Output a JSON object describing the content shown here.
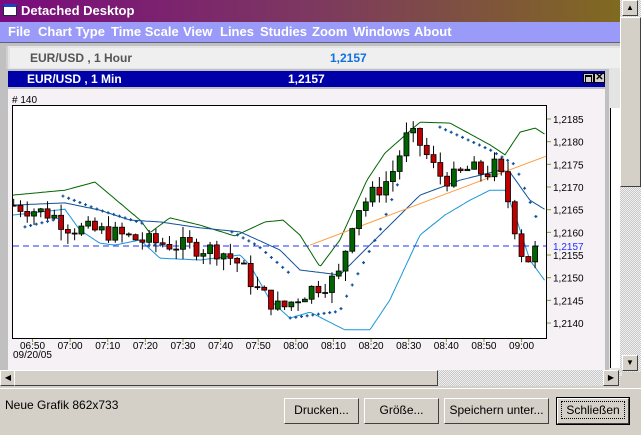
{
  "window": {
    "title": "Detached Desktop"
  },
  "menu": [
    "File",
    "Chart Type",
    "Time Scale",
    "View",
    "Lines",
    "Studies",
    "Zoom",
    "Windows",
    "About"
  ],
  "hour_window": {
    "title": "EUR/USD , 1 Hour",
    "price": "1,2157"
  },
  "min_window": {
    "title": "EUR/USD , 1 Min",
    "price": "1,2157",
    "bar_count": "# 140"
  },
  "status": {
    "text": "Neue Grafik 862x733"
  },
  "buttons": {
    "print": "Drucken...",
    "size": "Größe...",
    "save_as": "Speichern unter...",
    "close": "Schließen"
  },
  "colors": {
    "up": "#006400",
    "down": "#c00000",
    "upper_band": "#006400",
    "middle_band": "#10509a",
    "lower_band": "#1a96d8",
    "sar": "#10509a",
    "trendline": "#ff9a40",
    "hline": "#2030ff"
  },
  "chart_data": {
    "type": "candlestick",
    "symbol": "EUR/USD",
    "interval": "1 Min",
    "date_label": "09/20/05",
    "x_ticks": [
      "06:50",
      "07:00",
      "07:10",
      "07:20",
      "07:30",
      "07:40",
      "07:50",
      "08:00",
      "08:10",
      "08:20",
      "08:30",
      "08:40",
      "08:50",
      "09:00"
    ],
    "y_ticks": [
      "1,2140",
      "1,2145",
      "1,2150",
      "1,2155",
      "1,2160",
      "1,2165",
      "1,2170",
      "1,2175",
      "1,2180",
      "1,2185"
    ],
    "y_tick_values": [
      1.214,
      1.2145,
      1.215,
      1.2155,
      1.216,
      1.2165,
      1.217,
      1.2175,
      1.218,
      1.2185
    ],
    "ylim": [
      1.21362,
      1.21885
    ],
    "x_minutes_from_0650": [
      -5.4,
      136.5
    ],
    "price_path": [
      [
        -5,
        1.2166
      ],
      [
        0,
        1.2165
      ],
      [
        5,
        1.2164
      ],
      [
        10,
        1.2161
      ],
      [
        20,
        1.216
      ],
      [
        30,
        1.2158
      ],
      [
        40,
        1.2157
      ],
      [
        50,
        1.2156
      ],
      [
        55,
        1.2153
      ],
      [
        60,
        1.2147
      ],
      [
        66,
        1.2143
      ],
      [
        71,
        1.2146
      ],
      [
        75,
        1.2148
      ],
      [
        79,
        1.2149
      ],
      [
        82,
        1.2151
      ],
      [
        84,
        1.216
      ],
      [
        86,
        1.2165
      ],
      [
        90,
        1.2168
      ],
      [
        95,
        1.2172
      ],
      [
        98,
        1.2178
      ],
      [
        100,
        1.2182
      ],
      [
        103.5,
        1.2179
      ],
      [
        106,
        1.2175
      ],
      [
        109,
        1.2172
      ],
      [
        112,
        1.2172
      ],
      [
        116,
        1.2174
      ],
      [
        120.5,
        1.2173
      ],
      [
        123.5,
        1.2175
      ],
      [
        125,
        1.2171
      ],
      [
        127.5,
        1.2164
      ],
      [
        129.6,
        1.2156
      ],
      [
        132,
        1.2154
      ],
      [
        134.4,
        1.2157
      ]
    ],
    "upper_band": [
      [
        -5.4,
        1.21682
      ],
      [
        8.6,
        1.21693
      ],
      [
        16.6,
        1.21711
      ],
      [
        28.6,
        1.21627
      ],
      [
        31.2,
        1.21599
      ],
      [
        36.5,
        1.21632
      ],
      [
        44.5,
        1.21616
      ],
      [
        53.8,
        1.21592
      ],
      [
        61.8,
        1.21623
      ],
      [
        66.6,
        1.21627
      ],
      [
        71.1,
        1.21594
      ],
      [
        76.4,
        1.21524
      ],
      [
        81.7,
        1.21583
      ],
      [
        88.9,
        1.21715
      ],
      [
        93.7,
        1.21775
      ],
      [
        103,
        1.21843
      ],
      [
        111,
        1.21841
      ],
      [
        121.6,
        1.21793
      ],
      [
        125.6,
        1.21771
      ],
      [
        129.6,
        1.21821
      ],
      [
        133.6,
        1.2183
      ],
      [
        136.5,
        1.21815
      ]
    ],
    "middle_band": [
      [
        -5.4,
        1.2166
      ],
      [
        8.6,
        1.21665
      ],
      [
        17.9,
        1.21649
      ],
      [
        25.9,
        1.21627
      ],
      [
        33.9,
        1.21623
      ],
      [
        44.5,
        1.2161
      ],
      [
        55.2,
        1.21601
      ],
      [
        65.8,
        1.21561
      ],
      [
        71.1,
        1.21517
      ],
      [
        81.7,
        1.21506
      ],
      [
        87,
        1.2155
      ],
      [
        95,
        1.21616
      ],
      [
        103,
        1.21682
      ],
      [
        113.6,
        1.21715
      ],
      [
        124.3,
        1.21737
      ],
      [
        126.9,
        1.21733
      ],
      [
        132.2,
        1.21671
      ],
      [
        136.5,
        1.21649
      ]
    ],
    "lower_band": [
      [
        -5.4,
        1.21638
      ],
      [
        8.6,
        1.21651
      ],
      [
        12.6,
        1.21605
      ],
      [
        17.9,
        1.21576
      ],
      [
        21.9,
        1.21572
      ],
      [
        28.6,
        1.21583
      ],
      [
        33.9,
        1.21543
      ],
      [
        44.5,
        1.21539
      ],
      [
        55.2,
        1.2155
      ],
      [
        57.8,
        1.21528
      ],
      [
        63.1,
        1.21451
      ],
      [
        68.4,
        1.21411
      ],
      [
        73.8,
        1.21424
      ],
      [
        83,
        1.21385
      ],
      [
        89.7,
        1.21385
      ],
      [
        95,
        1.21451
      ],
      [
        103,
        1.21594
      ],
      [
        109.6,
        1.21638
      ],
      [
        116.3,
        1.21671
      ],
      [
        121.6,
        1.21693
      ],
      [
        125.6,
        1.21693
      ],
      [
        128.3,
        1.21638
      ],
      [
        132.2,
        1.21539
      ],
      [
        136.5,
        1.2149
      ]
    ],
    "parabolic_sar": [
      [
        [
          -2,
          1.21612
        ],
        [
          7.8,
          1.21632
        ]
      ],
      [
        [
          8.1,
          1.2168
        ],
        [
          17.9,
          1.21649
        ],
        [
          30,
          1.21618
        ]
      ],
      [
        [
          31,
          1.21572
        ],
        [
          35,
          1.21572
        ]
      ],
      [
        [
          53,
          1.21601
        ],
        [
          60,
          1.2157
        ],
        [
          68,
          1.21512
        ]
      ],
      [
        [
          68.5,
          1.21411
        ],
        [
          81.7,
          1.21426
        ],
        [
          83,
          1.21451
        ],
        [
          87,
          1.21517
        ],
        [
          92.4,
          1.21605
        ],
        [
          97.7,
          1.2172
        ]
      ],
      [
        [
          108.3,
          1.21832
        ],
        [
          121.6,
          1.21782
        ],
        [
          128.3,
          1.21749
        ],
        [
          135,
          1.2161
        ]
      ]
    ],
    "trendline": [
      [
        73.8,
        1.21572
      ],
      [
        136.5,
        1.21768
      ]
    ],
    "horizontal_line": {
      "value": 1.2157,
      "label": "1,2157"
    }
  }
}
